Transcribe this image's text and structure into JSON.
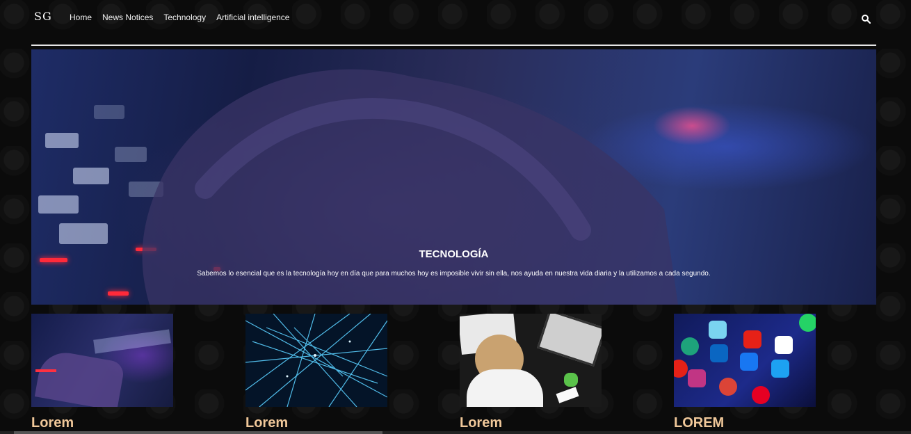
{
  "nav": {
    "logo": "SG",
    "items": [
      "Home",
      "News Notices",
      "Technology",
      "Artificial intelligence"
    ]
  },
  "hero": {
    "title": "TECNOLOGÍA",
    "description": "Sabemos lo esencial que es la tecnología hoy en día que para muchos hoy es imposible vivir sin ella, nos ayuda en nuestra vida diaria y la utilizamos a cada segundo."
  },
  "cards": [
    {
      "title": "Lorem"
    },
    {
      "title": "Lorem"
    },
    {
      "title": "Lorem"
    },
    {
      "title": "LOREM"
    }
  ]
}
